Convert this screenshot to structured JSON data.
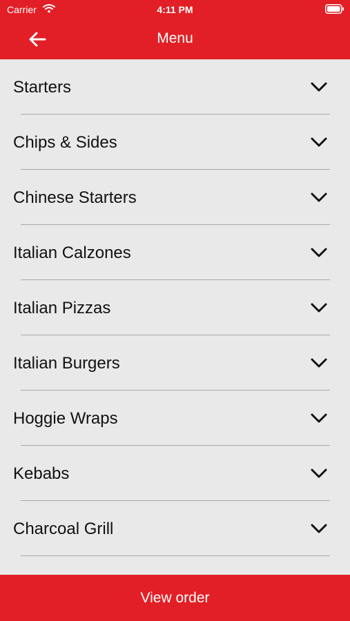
{
  "status_bar": {
    "carrier": "Carrier",
    "time": "4:11 PM",
    "icons": [
      "wifi-icon",
      "battery-icon"
    ]
  },
  "nav": {
    "title": "Menu",
    "back_icon": "back-arrow-icon"
  },
  "menu": {
    "items": [
      {
        "label": "Starters",
        "icon": "chevron-down-icon"
      },
      {
        "label": "Chips & Sides",
        "icon": "chevron-down-icon"
      },
      {
        "label": "Chinese Starters",
        "icon": "chevron-down-icon"
      },
      {
        "label": "Italian Calzones",
        "icon": "chevron-down-icon"
      },
      {
        "label": "Italian Pizzas",
        "icon": "chevron-down-icon"
      },
      {
        "label": "Italian Burgers",
        "icon": "chevron-down-icon"
      },
      {
        "label": "Hoggie Wraps",
        "icon": "chevron-down-icon"
      },
      {
        "label": "Kebabs",
        "icon": "chevron-down-icon"
      },
      {
        "label": "Charcoal Grill",
        "icon": "chevron-down-icon"
      }
    ]
  },
  "footer": {
    "view_order_label": "View order"
  },
  "colors": {
    "brand": "#e21f26",
    "background": "#e9e9e9",
    "divider": "#a8a8a8",
    "text": "#111111"
  }
}
